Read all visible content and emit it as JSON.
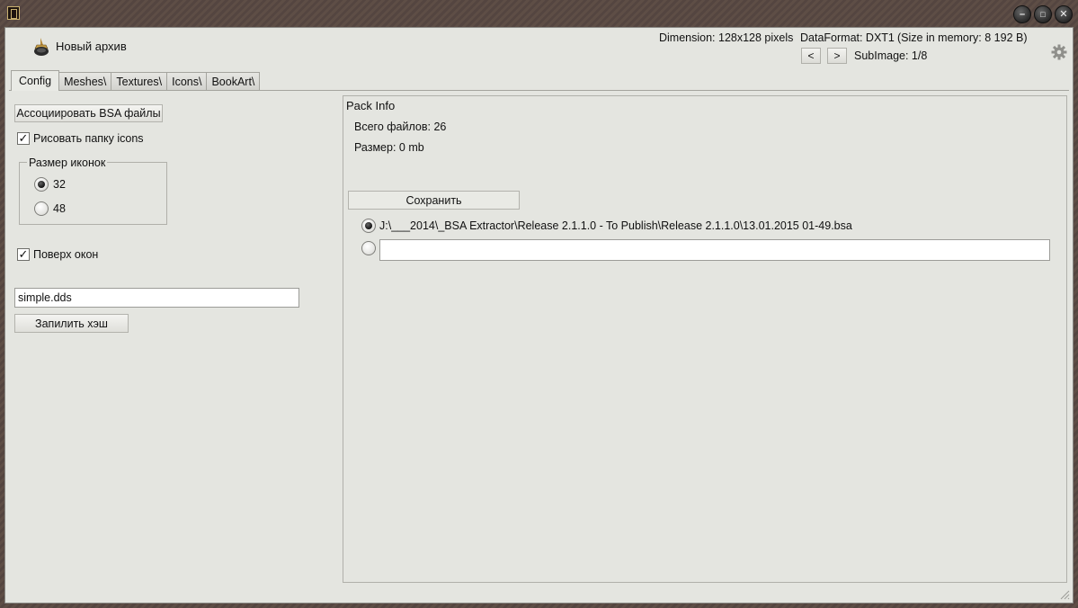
{
  "header": {
    "archive_title": "Новый архив",
    "dimension": "Dimension: 128x128 pixels",
    "dataformat": "DataFormat: DXT1",
    "size_in_memory": "(Size in memory: 8 192 B)",
    "prev_label": "<",
    "next_label": ">",
    "subimage": "SubImage: 1/8"
  },
  "tabs": [
    {
      "label": "Config",
      "active": true
    },
    {
      "label": "Meshes\\"
    },
    {
      "label": "Textures\\"
    },
    {
      "label": "Icons\\"
    },
    {
      "label": "BookArt\\"
    }
  ],
  "config": {
    "associate_label": "Ассоциировать BSA файлы",
    "draw_icons_label": "Рисовать папку icons",
    "draw_icons_checked": true,
    "icon_size_title": "Размер иконок",
    "icon_size_options": [
      "32",
      "48"
    ],
    "icon_size_selected": "32",
    "topmost_label": "Поверх окон",
    "topmost_checked": true,
    "filename_value": "simple.dds",
    "hash_button_label": "Запилить хэш"
  },
  "pack_info": {
    "title": "Pack Info",
    "total_files": "Всего файлов: 26",
    "size": "Размер: 0 mb",
    "save_label": "Сохранить",
    "path_option_1": "J:\\___2014\\_BSA Extractor\\Release 2.1.1.0 - To Publish\\Release 2.1.1.0\\13.01.2015 01-49.bsa",
    "path_option_2_value": ""
  },
  "window_controls": {
    "minimize": "–",
    "maximize": "□",
    "close": "✕"
  }
}
